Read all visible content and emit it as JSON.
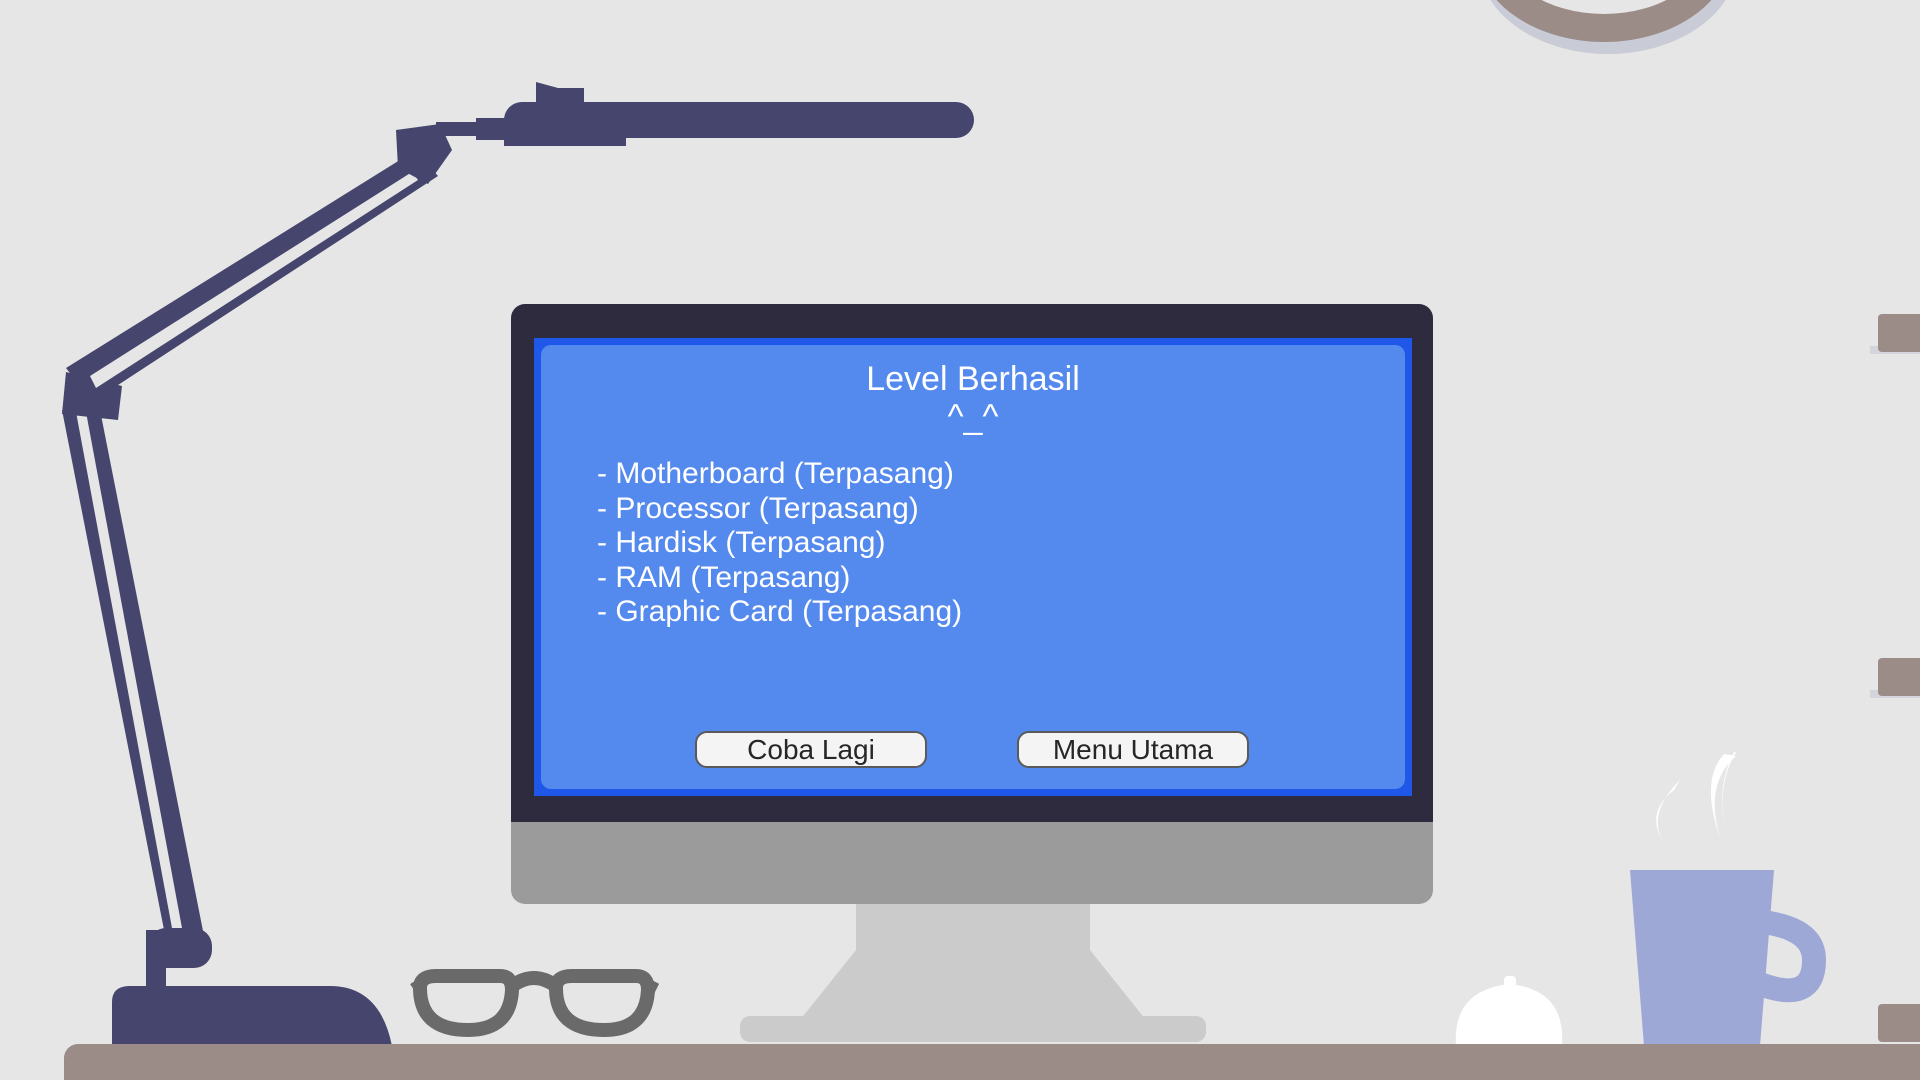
{
  "dialog": {
    "title": "Level Berhasil",
    "emoticon": "^_^",
    "items": [
      {
        "label": "- Motherboard (Terpasang)"
      },
      {
        "label": "- Processor (Terpasang)"
      },
      {
        "label": "- Hardisk (Terpasang)"
      },
      {
        "label": "- RAM (Terpasang)"
      },
      {
        "label": "- Graphic Card (Terpasang)"
      }
    ],
    "retry_label": "Coba Lagi",
    "main_menu_label": "Menu Utama"
  },
  "colors": {
    "wall": "#e6e6e6",
    "screen_border": "#1f58e8",
    "screen_panel": "#5489ee",
    "bezel": "#2d2b3d",
    "lamp": "#45456d",
    "mug": "#9ea8d6",
    "desk": "#9c8c88"
  },
  "icons": [
    "desk-lamp-icon",
    "glasses-icon",
    "coffee-mug-icon",
    "wall-clock-icon"
  ]
}
